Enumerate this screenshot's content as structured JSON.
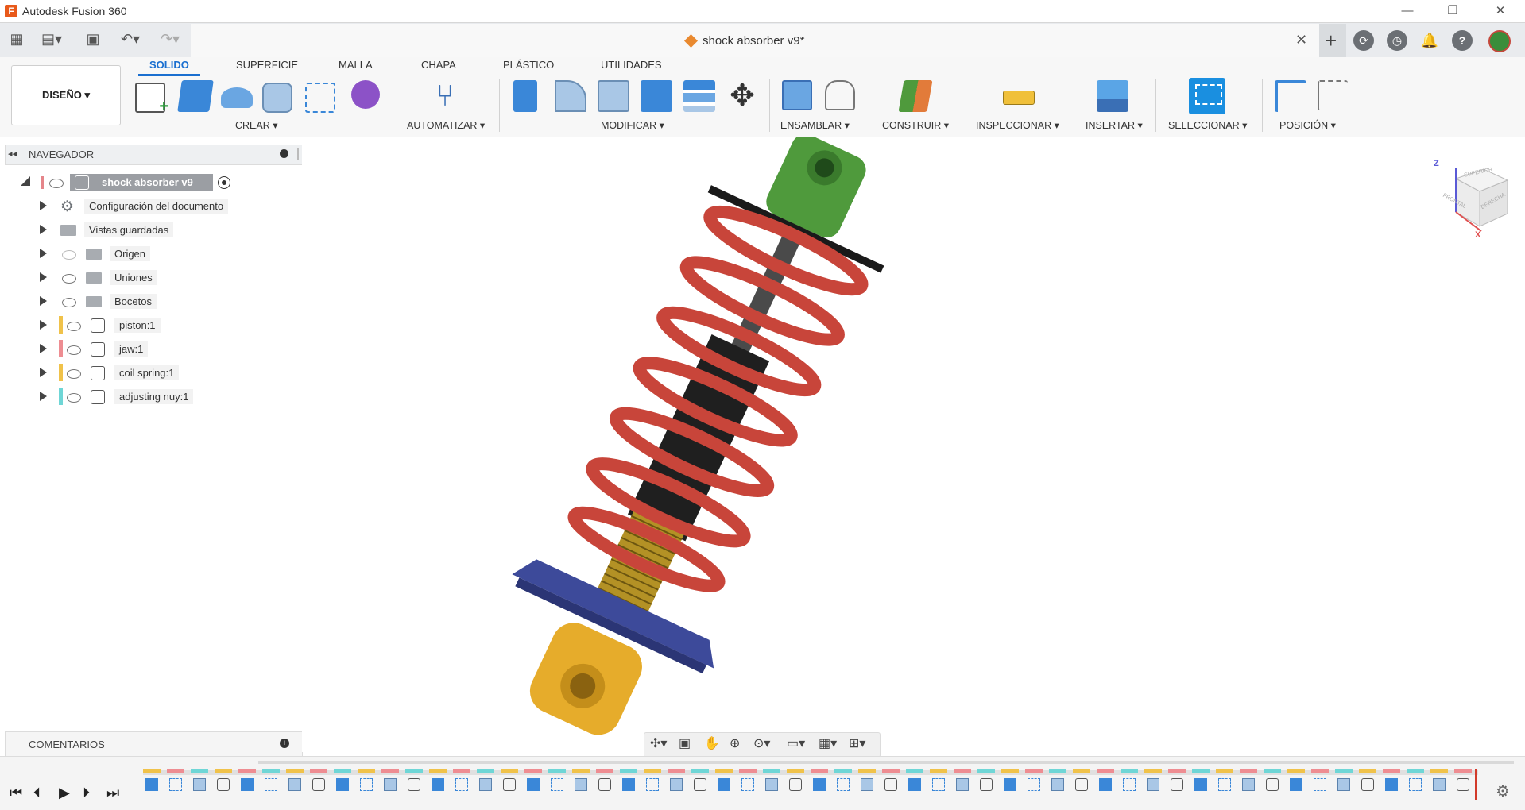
{
  "window": {
    "app_title": "Autodesk Fusion 360",
    "minimize": "—",
    "maximize": "❐",
    "close": "✕",
    "logo_letter": "F"
  },
  "document_tab": {
    "title": "shock absorber v9*",
    "close": "✕"
  },
  "quick_access": {
    "grid_icon": "grid-icon",
    "file_icon": "file-icon",
    "save_icon": "save-icon",
    "undo_icon": "undo-icon",
    "redo_icon": "redo-icon"
  },
  "top_right": {
    "plus": "+",
    "icons": [
      "extensions-icon",
      "job-status-icon",
      "notifications-icon",
      "help-icon",
      "avatar"
    ]
  },
  "ribbon": {
    "workspace": "DISEÑO ▾",
    "tabs": [
      "SOLIDO",
      "SUPERFICIE",
      "MALLA",
      "CHAPA",
      "PLÁSTICO",
      "UTILIDADES"
    ],
    "groups": {
      "crear": "CREAR ▾",
      "automatizar": "AUTOMATIZAR ▾",
      "modificar": "MODIFICAR ▾",
      "ensamblar": "ENSAMBLAR ▾",
      "construir": "CONSTRUIR ▾",
      "inspeccionar": "INSPECCIONAR ▾",
      "insertar": "INSERTAR ▾",
      "seleccionar": "SELECCIONAR ▾",
      "posicion": "POSICIÓN ▾"
    }
  },
  "browser": {
    "title": "NAVEGADOR",
    "root": "shock absorber v9",
    "items": [
      {
        "label": "Configuración del documento"
      },
      {
        "label": "Vistas guardadas"
      },
      {
        "label": "Origen"
      },
      {
        "label": "Uniones"
      },
      {
        "label": "Bocetos"
      },
      {
        "label": "piston:1"
      },
      {
        "label": "jaw:1"
      },
      {
        "label": "coil spring:1"
      },
      {
        "label": "adjusting nuy:1"
      }
    ]
  },
  "comments": {
    "title": "COMENTARIOS"
  },
  "viewcube": {
    "top": "SUPERIOR",
    "front": "FRONTAL",
    "right": "DERECHA",
    "z": "Z",
    "x": "X"
  },
  "colors": {
    "accent": "#1a6fd0",
    "spring": "#c8453a",
    "top_mount": "#4f9a3c",
    "bottom_mount": "#e6ac2b",
    "nut": "#3d4a9a",
    "body": "#1f1f1f"
  }
}
